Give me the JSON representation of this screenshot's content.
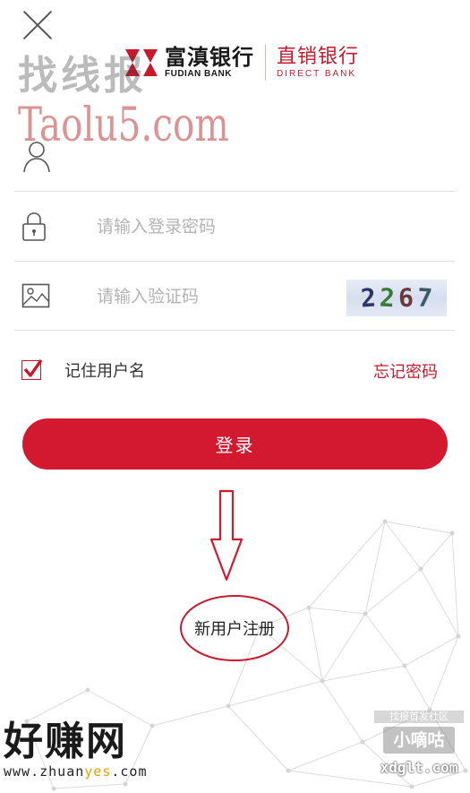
{
  "header": {
    "close_icon": "close-icon",
    "bank_name_cn": "富滇银行",
    "bank_name_en": "FUDIAN BANK",
    "direct_name_cn": "直销银行",
    "direct_name_en": "DIRECT BANK",
    "brand_color": "#c71a2c"
  },
  "form": {
    "username": {
      "value": "",
      "placeholder": "",
      "icon": "user-icon"
    },
    "password": {
      "value": "",
      "placeholder": "请输入登录密码",
      "icon": "lock-icon"
    },
    "captcha": {
      "value": "",
      "placeholder": "请输入验证码",
      "icon": "image-icon",
      "code": [
        "2",
        "2",
        "6",
        "7"
      ]
    },
    "remember_label": "记住用户名",
    "remember_checked": true,
    "forgot_label": "忘记密码",
    "login_label": "登录",
    "login_color": "#d3192f"
  },
  "register_label": "新用户注册",
  "watermarks": {
    "top_cn": "找线报",
    "top_url": "Taolu5.com",
    "bottom_left_cn": "好赚网",
    "bottom_left_url_a": "www.zhuan",
    "bottom_left_url_b": "yes",
    "bottom_left_url_c": ".com",
    "bottom_right_top": "找报首发社区",
    "bottom_right_name": "小嘀咕",
    "bottom_right_url": "xdglt.com"
  }
}
